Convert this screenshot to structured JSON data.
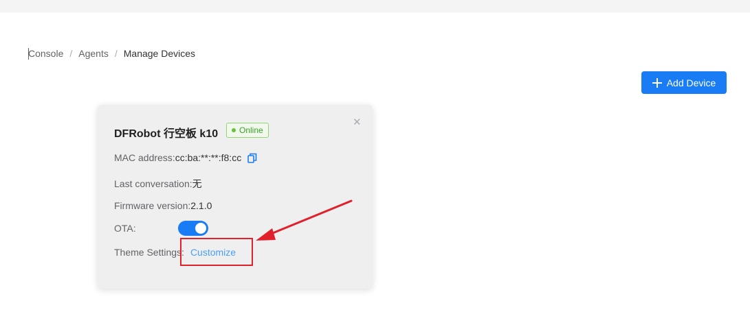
{
  "breadcrumb": {
    "items": [
      {
        "label": "Console"
      },
      {
        "label": "Agents"
      },
      {
        "label": "Manage Devices"
      }
    ],
    "separator": "/"
  },
  "toolbar": {
    "add_device_label": "Add Device"
  },
  "device_card": {
    "name": "DFRobot 行空板 k10",
    "status": "Online",
    "mac_label": "MAC address:",
    "mac_value": "cc:ba:**:**:f8:cc",
    "last_conversation_label": "Last conversation:",
    "last_conversation_value": "无",
    "firmware_label": "Firmware version:",
    "firmware_value": "2.1.0",
    "ota_label": "OTA:",
    "ota_enabled": true,
    "theme_label": "Theme Settings:",
    "theme_link": "Customize"
  },
  "colors": {
    "primary": "#1a7cf5",
    "status_green": "#67c23a",
    "annotation_red": "#e0202a",
    "link": "#4a9ff5"
  },
  "icons": {
    "add": "plus-icon",
    "copy": "copy-icon",
    "close": "close-icon",
    "status": "status-dot-icon"
  }
}
